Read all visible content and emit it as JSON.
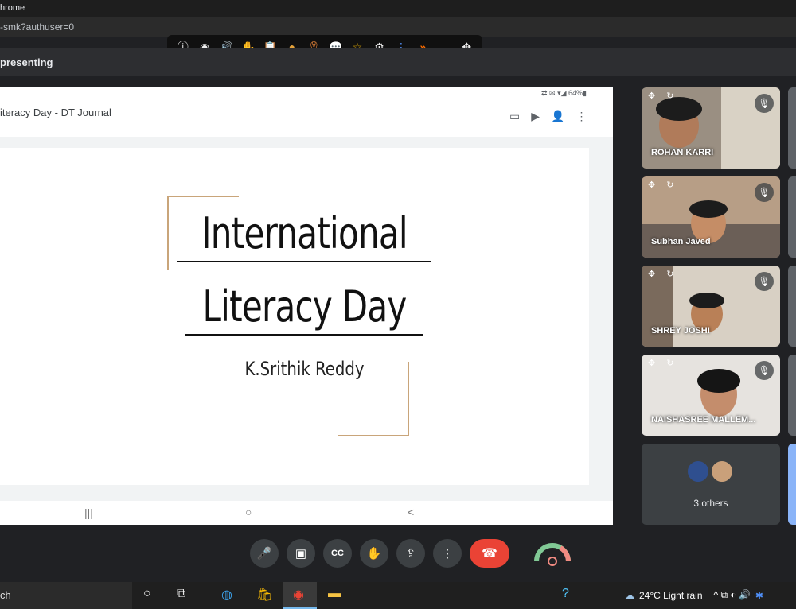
{
  "browser": {
    "title": "hrome",
    "url": "-smk?authuser=0"
  },
  "extension_toolbar": {
    "icons": [
      "info-icon",
      "eye-icon",
      "speaker-icon",
      "hand-icon",
      "clipboard-icon",
      "emoji-icon",
      "award-icon",
      "chat-icon",
      "star-icon",
      "gear-icon",
      "more-icon",
      "forward-icon",
      "minimize-icon",
      "move-icon"
    ],
    "glyphs": [
      "ⓘ",
      "◉",
      "🔊",
      "✋",
      "📋",
      "●",
      "🎗",
      "💬",
      "☆",
      "⚙",
      "⋮",
      "»",
      "_",
      "✥"
    ]
  },
  "meet": {
    "presenting_label": "presenting"
  },
  "presented": {
    "status": "⇄ ✉ ▾◢ 64%▮",
    "doc_title": "iteracy Day - DT Journal",
    "toolbar_glyphs": [
      "▭",
      "▶",
      "👤",
      "⋮"
    ],
    "slide": {
      "title_line1": "International",
      "title_line2": "Literacy Day",
      "author": "K.Srithik Reddy"
    },
    "nav": {
      "recents": "|||",
      "home": "○",
      "back": "<"
    }
  },
  "participants": [
    {
      "name": "ROHAN KARRI"
    },
    {
      "name": "Subhan Javed"
    },
    {
      "name": "SHREY JOSHI"
    },
    {
      "name": "NAISHASREE MALLEM..."
    }
  ],
  "others_label": "3 others",
  "controls": {
    "mic": "🎤",
    "camera": "▣",
    "captions": "CC",
    "raise_hand": "✋",
    "present": "⇪",
    "more": "⋮",
    "end": "☎"
  },
  "taskbar": {
    "search_text": "ch",
    "weather": "24°C  Light rain",
    "tray": "^ ⧉ ◐ 🔊"
  },
  "colors": {
    "end_call": "#ea4335",
    "frame": "#c9a57a",
    "meet_bg": "#202124"
  }
}
